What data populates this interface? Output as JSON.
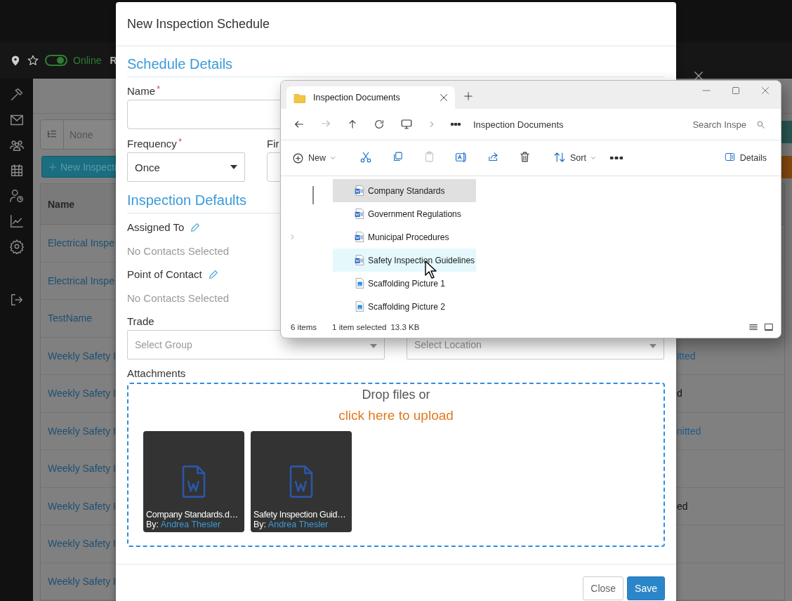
{
  "top_bar": {
    "status": {
      "label": "Online",
      "on": true
    },
    "user_initial": "R"
  },
  "page": {
    "filter": {
      "value": "None"
    },
    "new_button": "New Inspecti",
    "table": {
      "columns": [
        "Name"
      ],
      "rows": [
        {
          "name": "Electrical Inspe"
        },
        {
          "name": "Electrical Inspe"
        },
        {
          "name": "TestName"
        },
        {
          "name": "Weekly Safety I",
          "status": "itted",
          "kind": "link"
        },
        {
          "name": "Weekly Safety I",
          "status": "d",
          "kind": "plain"
        },
        {
          "name": "Weekly Safety I",
          "status": "nitted",
          "kind": "link"
        },
        {
          "name": "Weekly Safety I"
        },
        {
          "name": "Weekly Safety I",
          "status": "ed",
          "kind": "plain"
        },
        {
          "name": "Weekly Safety I"
        },
        {
          "name": "Weekly Safety I"
        }
      ]
    }
  },
  "modal": {
    "title": "New Inspection Schedule",
    "schedule_details": {
      "heading": "Schedule Details",
      "name": {
        "label": "Name",
        "required_mark": "*"
      },
      "frequency": {
        "label": "Frequency",
        "required_mark": "*",
        "value": "Once"
      },
      "first": {
        "label": "Fir"
      }
    },
    "inspection_defaults": {
      "heading": "Inspection Defaults",
      "assigned_to": {
        "label": "Assigned To",
        "value": "No Contacts Selected"
      },
      "point_of_contact": {
        "label": "Point of Contact",
        "value": "No Contacts Selected"
      },
      "trade": {
        "label": "Trade",
        "group_placeholder": "Select Group",
        "location_placeholder": "Select Location"
      }
    },
    "attachments": {
      "label": "Attachments",
      "drop_text": "Drop files or",
      "upload_link": "click here to upload",
      "files": [
        {
          "name": "Company Standards.d…",
          "by_label": "By:",
          "author": "Andrea Thesler"
        },
        {
          "name": "Safety Inspection Guid…",
          "by_label": "By:",
          "author": "Andrea Thesler"
        }
      ]
    },
    "buttons": [
      {
        "label": "Close",
        "kind": "secondary"
      },
      {
        "label": "Save",
        "kind": "primary"
      }
    ]
  },
  "explorer": {
    "tab_title": "Inspection Documents",
    "breadcrumb": "Inspection Documents",
    "search_placeholder": "Search Inspe",
    "forward_disabled": true,
    "paste_disabled": true,
    "toolbar": {
      "new": "New",
      "sort": "Sort",
      "details": "Details"
    },
    "files": [
      {
        "name": "Company Standards",
        "kind": "word",
        "selected": true,
        "hovered": false
      },
      {
        "name": "Government Regulations",
        "kind": "word",
        "selected": false,
        "hovered": false
      },
      {
        "name": "Municipal Procedures",
        "kind": "word",
        "selected": false,
        "hovered": false
      },
      {
        "name": "Safety Inspection Guidelines",
        "kind": "word",
        "selected": false,
        "hovered": true
      },
      {
        "name": "Scaffolding Picture 1",
        "kind": "image",
        "selected": false,
        "hovered": false
      },
      {
        "name": "Scaffolding Picture 2",
        "kind": "image",
        "selected": false,
        "hovered": false
      }
    ],
    "status": {
      "count": "6 items",
      "selection": "1 item selected",
      "size": "13.3 KB"
    }
  }
}
